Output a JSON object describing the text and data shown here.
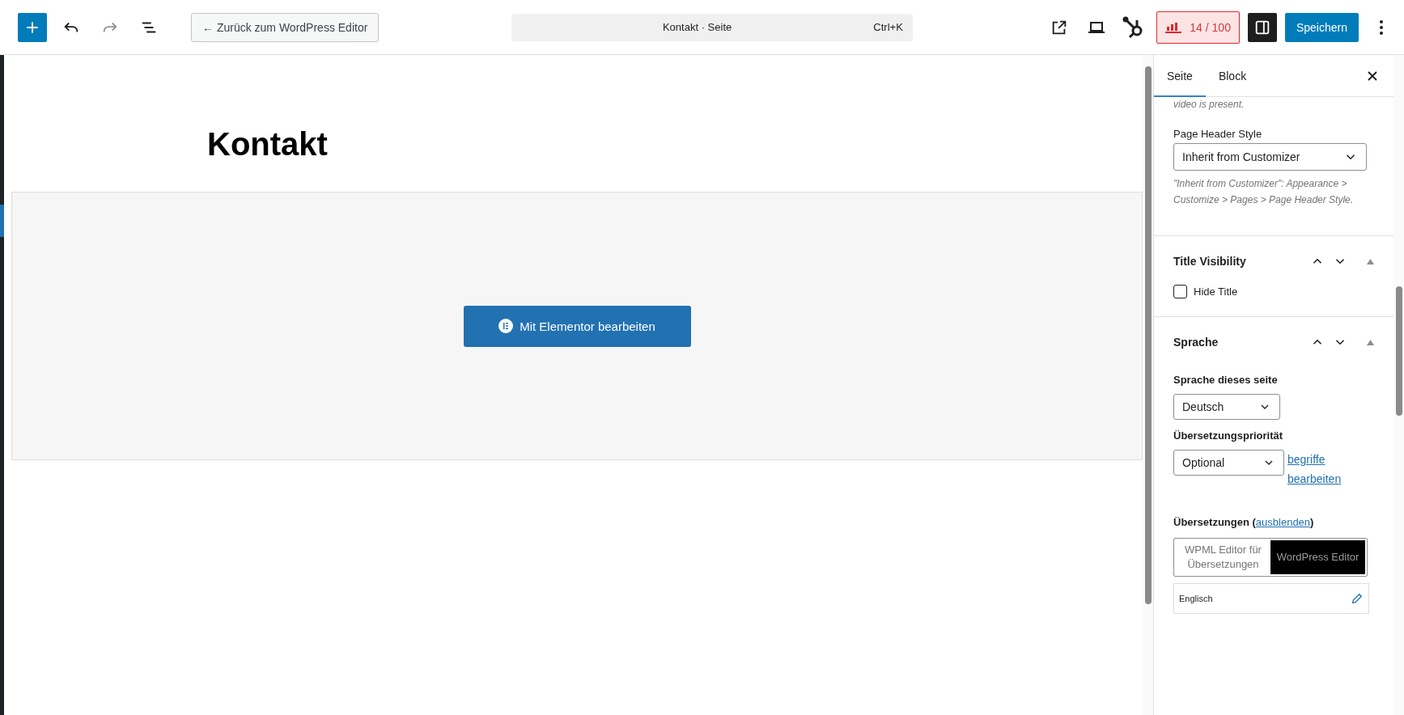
{
  "toolbar": {
    "back_button": "← Zurück zum WordPress Editor",
    "command_bar": {
      "title": "Kontakt · Seite",
      "shortcut": "Ctrl+K"
    },
    "seo_score": "14 / 100",
    "save_button": "Speichern",
    "settings_open": true
  },
  "editor": {
    "title": "Kontakt",
    "elementor_button": "Mit Elementor bearbeiten"
  },
  "sidebar": {
    "tabs": [
      {
        "label": "Seite",
        "selected": true
      },
      {
        "label": "Block",
        "selected": false
      }
    ],
    "cut_note": "video is present.",
    "header_style": {
      "label": "Page Header Style",
      "value": "Inherit from Customizer",
      "help": "\"Inherit from Customizer\": Appearance > Customize > Pages > Page Header Style."
    },
    "title_visibility": {
      "title": "Title Visibility",
      "expanded": true,
      "checkbox": {
        "label": "Hide Title",
        "checked": false
      }
    },
    "language": {
      "title": "Sprache",
      "expanded": true,
      "page_language_label": "Sprache dieses seite",
      "page_language": "Deutsch",
      "priority_label": "Übersetzungspriorität",
      "priority": "Optional",
      "terms_link": "begriffe bearbeiten",
      "translations_label": {
        "before": "Übersetzungen (",
        "link": "ausblenden",
        "after": ")"
      },
      "editor_options": [
        {
          "label": "WPML Editor für Übersetzungen",
          "selected": false
        },
        {
          "label": "WordPress Editor",
          "selected": true
        }
      ],
      "translations": [
        {
          "language": "Englisch"
        }
      ]
    }
  }
}
